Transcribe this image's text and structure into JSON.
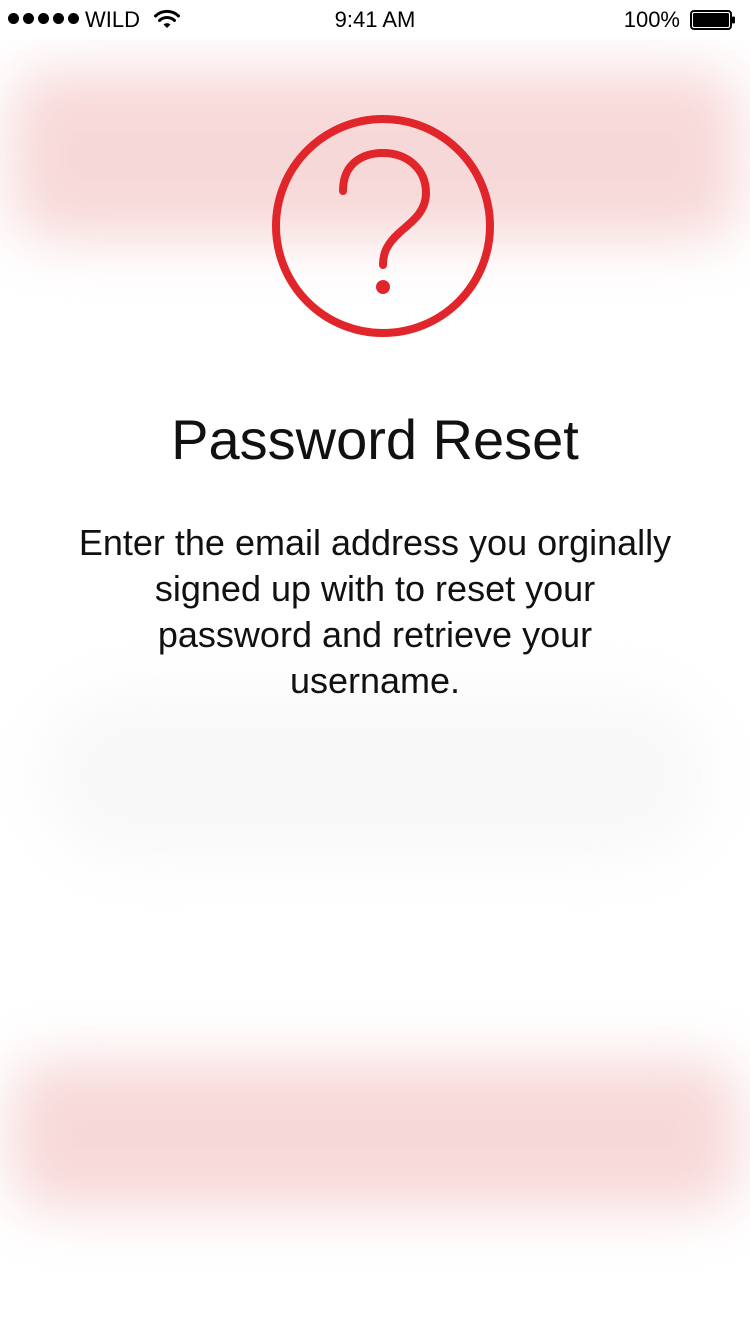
{
  "status_bar": {
    "carrier": "WILD",
    "time": "9:41 AM",
    "battery": "100%",
    "signal_bars": 5,
    "icons": [
      "signal-dots-icon",
      "wifi-icon",
      "battery-icon"
    ]
  },
  "hero": {
    "icon": "question-mark-circle-icon",
    "accent_color": "#e0262b"
  },
  "content": {
    "title": "Password Reset",
    "description": "Enter the email address you orginally signed up with to reset your password and retrieve your username."
  }
}
